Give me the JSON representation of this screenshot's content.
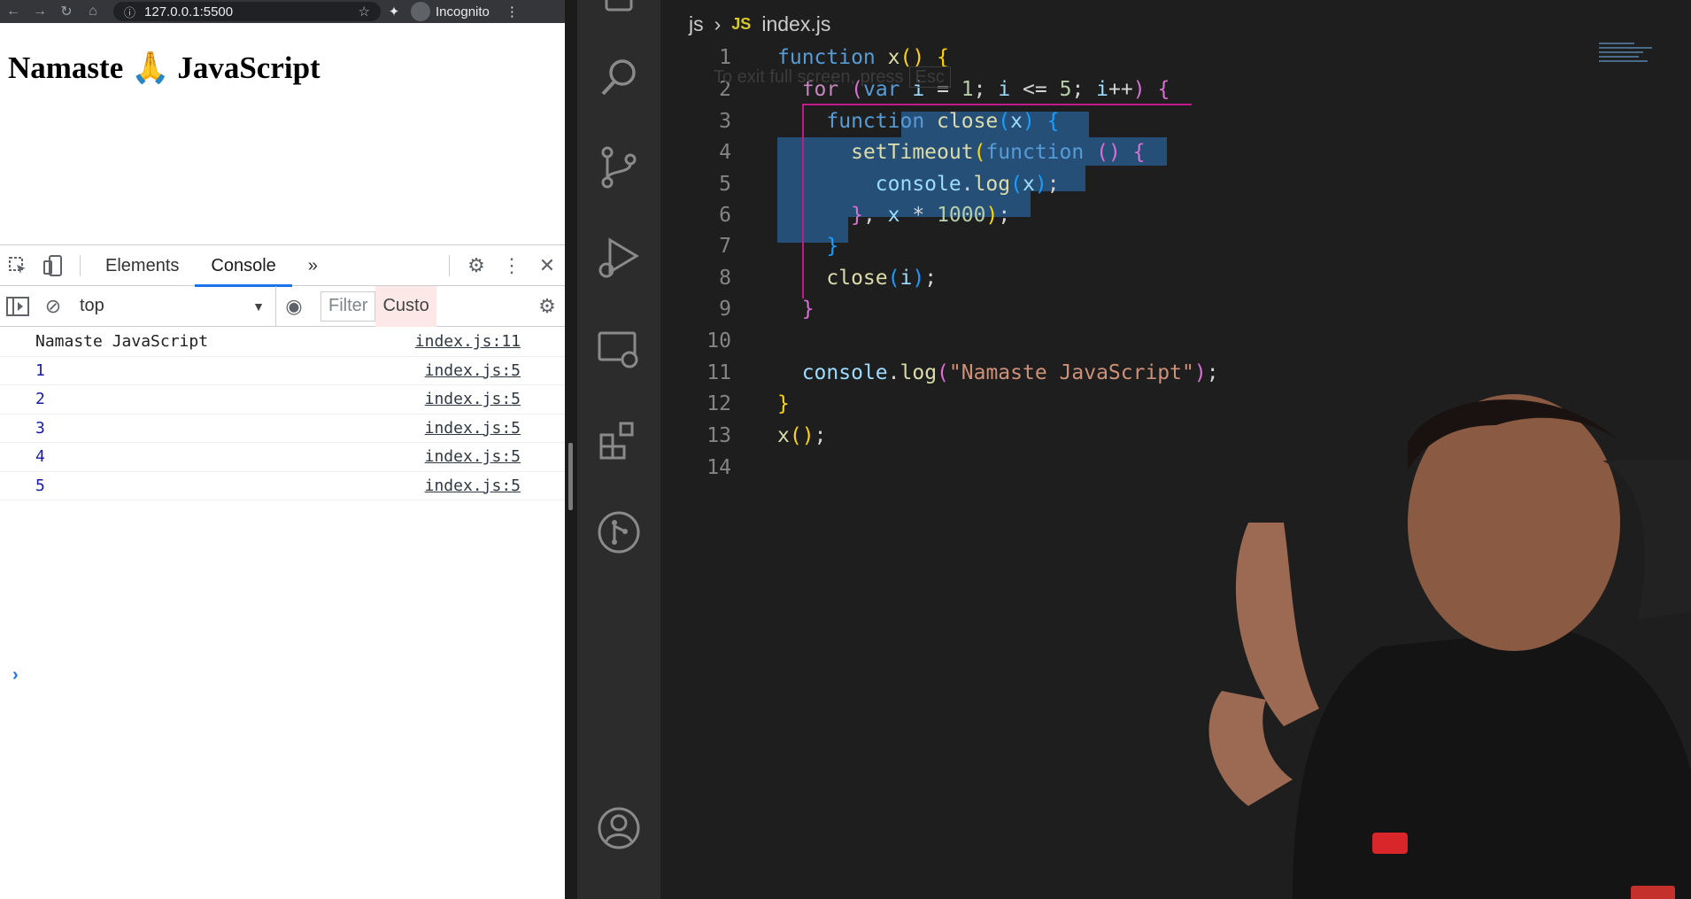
{
  "browser": {
    "url": "127.0.0.1:5500",
    "incognito_label": "Incognito",
    "page_heading": "Namaste 🙏 JavaScript"
  },
  "devtools": {
    "tabs": [
      {
        "label": "Elements",
        "active": false
      },
      {
        "label": "Console",
        "active": true
      }
    ],
    "more_tabs": "»",
    "context": "top",
    "filter_placeholder": "Filter",
    "levels_label": "Custo",
    "console": [
      {
        "text": "Namaste JavaScript",
        "source": "index.js:11"
      },
      {
        "text": "1",
        "source": "index.js:5"
      },
      {
        "text": "2",
        "source": "index.js:5"
      },
      {
        "text": "3",
        "source": "index.js:5"
      },
      {
        "text": "4",
        "source": "index.js:5"
      },
      {
        "text": "5",
        "source": "index.js:5"
      }
    ],
    "prompt": "›"
  },
  "editor": {
    "breadcrumb": {
      "folder": "js",
      "badge": "JS",
      "file": "index.js"
    },
    "fullscreen_hint": "To exit full screen, press",
    "fullscreen_key": "Esc",
    "line_numbers": [
      "1",
      "2",
      "3",
      "4",
      "5",
      "6",
      "7",
      "8",
      "9",
      "10",
      "11",
      "12",
      "13",
      "14"
    ],
    "code_lines": [
      "function x() {",
      "  for (var i = 1; i <= 5; i++) {",
      "    function close(x) {",
      "      setTimeout(function () {",
      "        console.log(x);",
      "      }, x * 1000);",
      "    }",
      "    close(i);",
      "  }",
      "",
      "  console.log(\"Namaste JavaScript\");",
      "}",
      "x();",
      ""
    ]
  },
  "icons": [
    "back-icon",
    "forward-icon",
    "reload-icon",
    "home-icon",
    "info-icon",
    "star-icon",
    "extension-icon",
    "incognito-icon",
    "menu-icon",
    "inspect-icon",
    "device-icon",
    "settings-icon",
    "more-icon",
    "close-icon",
    "sidebar-icon",
    "clear-icon",
    "eye-icon",
    "search-icon",
    "source-control-icon",
    "run-debug-icon",
    "remote-explorer-icon",
    "extensions-icon",
    "git-graph-icon",
    "account-icon"
  ],
  "colors": {
    "accent": "#1a73e8",
    "selection": "#264f78",
    "editor_bg": "#1e1e1e"
  }
}
